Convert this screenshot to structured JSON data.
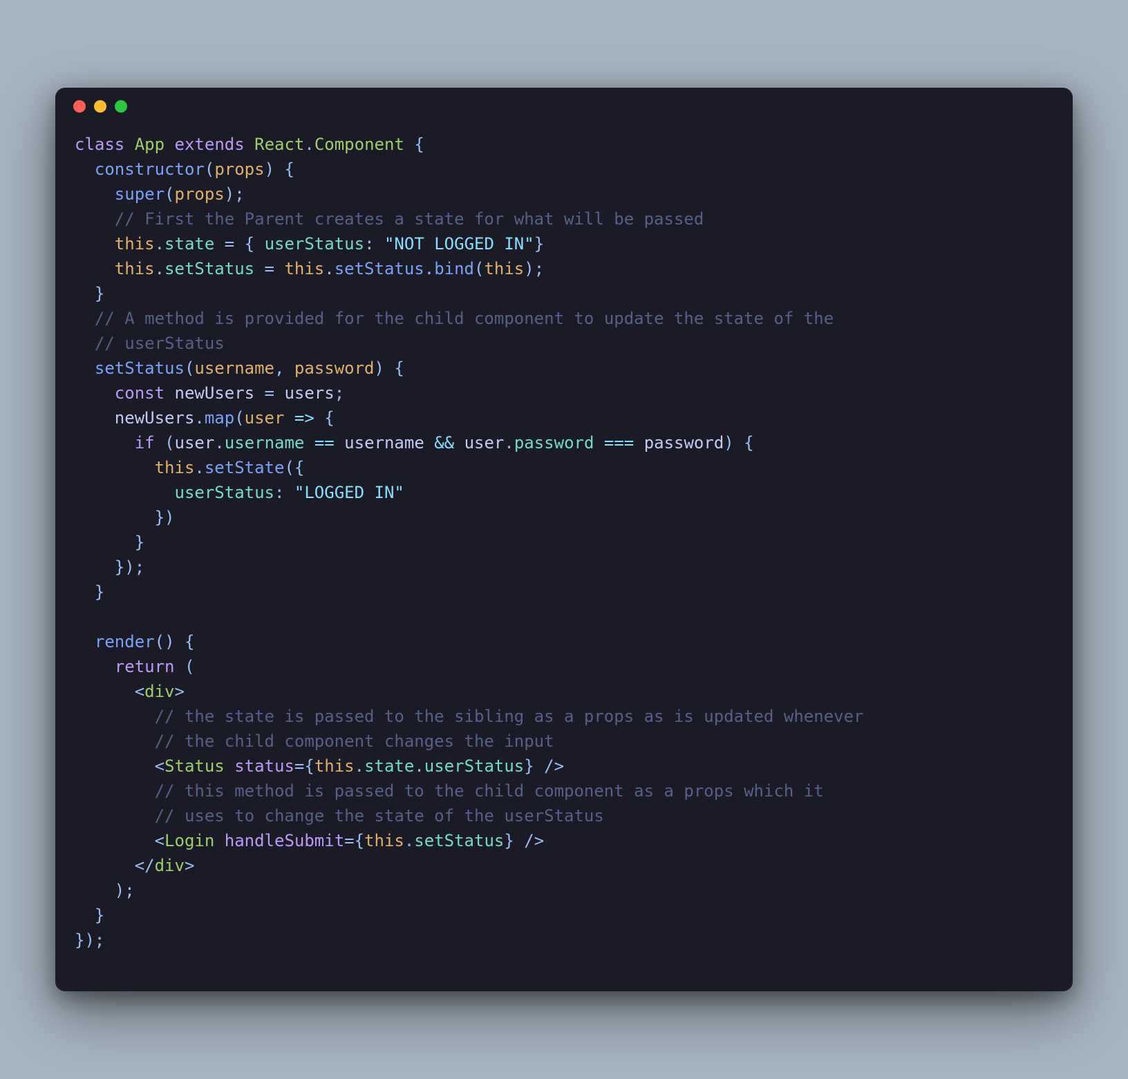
{
  "colors": {
    "page_bg": "#a5b3c0",
    "window_bg": "#1a1b26",
    "traffic_close": "#ff5f56",
    "traffic_min": "#ffbd2e",
    "traffic_zoom": "#27c93f",
    "keyword": "#bb9af7",
    "classname": "#9ece6a",
    "function": "#7aa2f7",
    "param": "#e0af68",
    "property": "#73daca",
    "string": "#89ddff",
    "punct": "#9abdf5",
    "operator": "#89ddff",
    "comment": "#565f89",
    "default": "#c0caf5"
  },
  "code": {
    "lines": [
      [
        {
          "t": "class",
          "c": "kw"
        },
        {
          "t": " "
        },
        {
          "t": "App",
          "c": "class"
        },
        {
          "t": " "
        },
        {
          "t": "extends",
          "c": "kw"
        },
        {
          "t": " "
        },
        {
          "t": "React",
          "c": "class"
        },
        {
          "t": ".",
          "c": "punc"
        },
        {
          "t": "Component",
          "c": "class"
        },
        {
          "t": " "
        },
        {
          "t": "{",
          "c": "punc"
        }
      ],
      [
        {
          "t": "  "
        },
        {
          "t": "constructor",
          "c": "fn"
        },
        {
          "t": "(",
          "c": "punc"
        },
        {
          "t": "props",
          "c": "param"
        },
        {
          "t": ")",
          "c": "punc"
        },
        {
          "t": " "
        },
        {
          "t": "{",
          "c": "punc"
        }
      ],
      [
        {
          "t": "    "
        },
        {
          "t": "super",
          "c": "fn"
        },
        {
          "t": "(",
          "c": "punc"
        },
        {
          "t": "props",
          "c": "param"
        },
        {
          "t": ")",
          "c": "punc"
        },
        {
          "t": ";",
          "c": "punc"
        }
      ],
      [
        {
          "t": "    "
        },
        {
          "t": "// First the Parent creates a state for what will be passed",
          "c": "cmt"
        }
      ],
      [
        {
          "t": "    "
        },
        {
          "t": "this",
          "c": "this"
        },
        {
          "t": ".",
          "c": "punc"
        },
        {
          "t": "state",
          "c": "prop"
        },
        {
          "t": " "
        },
        {
          "t": "=",
          "c": "punc"
        },
        {
          "t": " "
        },
        {
          "t": "{",
          "c": "punc"
        },
        {
          "t": " "
        },
        {
          "t": "userStatus",
          "c": "key"
        },
        {
          "t": ":",
          "c": "punc"
        },
        {
          "t": " "
        },
        {
          "t": "\"NOT LOGGED IN\"",
          "c": "str"
        },
        {
          "t": "}",
          "c": "punc"
        }
      ],
      [
        {
          "t": "    "
        },
        {
          "t": "this",
          "c": "this"
        },
        {
          "t": ".",
          "c": "punc"
        },
        {
          "t": "setStatus",
          "c": "prop"
        },
        {
          "t": " "
        },
        {
          "t": "=",
          "c": "punc"
        },
        {
          "t": " "
        },
        {
          "t": "this",
          "c": "this"
        },
        {
          "t": ".",
          "c": "punc"
        },
        {
          "t": "setStatus",
          "c": "fn"
        },
        {
          "t": ".",
          "c": "punc"
        },
        {
          "t": "bind",
          "c": "fn"
        },
        {
          "t": "(",
          "c": "punc"
        },
        {
          "t": "this",
          "c": "this"
        },
        {
          "t": ")",
          "c": "punc"
        },
        {
          "t": ";",
          "c": "punc"
        }
      ],
      [
        {
          "t": "  "
        },
        {
          "t": "}",
          "c": "punc"
        }
      ],
      [
        {
          "t": "  "
        },
        {
          "t": "// A method is provided for the child component to update the state of the",
          "c": "cmt"
        }
      ],
      [
        {
          "t": "  "
        },
        {
          "t": "// userStatus",
          "c": "cmt"
        }
      ],
      [
        {
          "t": "  "
        },
        {
          "t": "setStatus",
          "c": "fn"
        },
        {
          "t": "(",
          "c": "punc"
        },
        {
          "t": "username",
          "c": "param"
        },
        {
          "t": ",",
          "c": "punc"
        },
        {
          "t": " "
        },
        {
          "t": "password",
          "c": "param"
        },
        {
          "t": ")",
          "c": "punc"
        },
        {
          "t": " "
        },
        {
          "t": "{",
          "c": "punc"
        }
      ],
      [
        {
          "t": "    "
        },
        {
          "t": "const",
          "c": "kw"
        },
        {
          "t": " "
        },
        {
          "t": "newUsers",
          "c": "var"
        },
        {
          "t": " "
        },
        {
          "t": "=",
          "c": "punc"
        },
        {
          "t": " "
        },
        {
          "t": "users",
          "c": "var"
        },
        {
          "t": ";",
          "c": "punc"
        }
      ],
      [
        {
          "t": "    "
        },
        {
          "t": "newUsers",
          "c": "var"
        },
        {
          "t": ".",
          "c": "punc"
        },
        {
          "t": "map",
          "c": "fn"
        },
        {
          "t": "(",
          "c": "punc"
        },
        {
          "t": "user",
          "c": "param"
        },
        {
          "t": " "
        },
        {
          "t": "=>",
          "c": "op"
        },
        {
          "t": " "
        },
        {
          "t": "{",
          "c": "punc"
        }
      ],
      [
        {
          "t": "      "
        },
        {
          "t": "if",
          "c": "kw"
        },
        {
          "t": " "
        },
        {
          "t": "(",
          "c": "punc"
        },
        {
          "t": "user",
          "c": "var"
        },
        {
          "t": ".",
          "c": "punc"
        },
        {
          "t": "username",
          "c": "prop"
        },
        {
          "t": " "
        },
        {
          "t": "==",
          "c": "op"
        },
        {
          "t": " "
        },
        {
          "t": "username",
          "c": "var"
        },
        {
          "t": " "
        },
        {
          "t": "&&",
          "c": "op"
        },
        {
          "t": " "
        },
        {
          "t": "user",
          "c": "var"
        },
        {
          "t": ".",
          "c": "punc"
        },
        {
          "t": "password",
          "c": "prop"
        },
        {
          "t": " "
        },
        {
          "t": "===",
          "c": "op"
        },
        {
          "t": " "
        },
        {
          "t": "password",
          "c": "var"
        },
        {
          "t": ")",
          "c": "punc"
        },
        {
          "t": " "
        },
        {
          "t": "{",
          "c": "punc"
        }
      ],
      [
        {
          "t": "        "
        },
        {
          "t": "this",
          "c": "this"
        },
        {
          "t": ".",
          "c": "punc"
        },
        {
          "t": "setState",
          "c": "fn"
        },
        {
          "t": "(",
          "c": "punc"
        },
        {
          "t": "{",
          "c": "punc"
        }
      ],
      [
        {
          "t": "          "
        },
        {
          "t": "userStatus",
          "c": "key"
        },
        {
          "t": ":",
          "c": "punc"
        },
        {
          "t": " "
        },
        {
          "t": "\"LOGGED IN\"",
          "c": "str"
        }
      ],
      [
        {
          "t": "        "
        },
        {
          "t": "}",
          "c": "punc"
        },
        {
          "t": ")",
          "c": "punc"
        }
      ],
      [
        {
          "t": "      "
        },
        {
          "t": "}",
          "c": "punc"
        }
      ],
      [
        {
          "t": "    "
        },
        {
          "t": "}",
          "c": "punc"
        },
        {
          "t": ")",
          "c": "punc"
        },
        {
          "t": ";",
          "c": "punc"
        }
      ],
      [
        {
          "t": "  "
        },
        {
          "t": "}",
          "c": "punc"
        }
      ],
      [
        {
          "t": ""
        }
      ],
      [
        {
          "t": "  "
        },
        {
          "t": "render",
          "c": "fn"
        },
        {
          "t": "(",
          "c": "punc"
        },
        {
          "t": ")",
          "c": "punc"
        },
        {
          "t": " "
        },
        {
          "t": "{",
          "c": "punc"
        }
      ],
      [
        {
          "t": "    "
        },
        {
          "t": "return",
          "c": "kw"
        },
        {
          "t": " "
        },
        {
          "t": "(",
          "c": "punc"
        }
      ],
      [
        {
          "t": "      "
        },
        {
          "t": "<",
          "c": "punc"
        },
        {
          "t": "div",
          "c": "class"
        },
        {
          "t": ">",
          "c": "punc"
        }
      ],
      [
        {
          "t": "        "
        },
        {
          "t": "// the state is passed to the sibling as a props as is updated whenever",
          "c": "cmt"
        }
      ],
      [
        {
          "t": "        "
        },
        {
          "t": "// the child component changes the input",
          "c": "cmt"
        }
      ],
      [
        {
          "t": "        "
        },
        {
          "t": "<",
          "c": "punc"
        },
        {
          "t": "Status",
          "c": "class"
        },
        {
          "t": " "
        },
        {
          "t": "status",
          "c": "attr"
        },
        {
          "t": "=",
          "c": "punc"
        },
        {
          "t": "{",
          "c": "punc"
        },
        {
          "t": "this",
          "c": "this"
        },
        {
          "t": ".",
          "c": "punc"
        },
        {
          "t": "state",
          "c": "prop"
        },
        {
          "t": ".",
          "c": "punc"
        },
        {
          "t": "userStatus",
          "c": "prop"
        },
        {
          "t": "}",
          "c": "punc"
        },
        {
          "t": " "
        },
        {
          "t": "/>",
          "c": "punc"
        }
      ],
      [
        {
          "t": "        "
        },
        {
          "t": "// this method is passed to the child component as a props which it",
          "c": "cmt"
        }
      ],
      [
        {
          "t": "        "
        },
        {
          "t": "// uses to change the state of the userStatus",
          "c": "cmt"
        }
      ],
      [
        {
          "t": "        "
        },
        {
          "t": "<",
          "c": "punc"
        },
        {
          "t": "Login",
          "c": "class"
        },
        {
          "t": " "
        },
        {
          "t": "handleSubmit",
          "c": "attr"
        },
        {
          "t": "=",
          "c": "punc"
        },
        {
          "t": "{",
          "c": "punc"
        },
        {
          "t": "this",
          "c": "this"
        },
        {
          "t": ".",
          "c": "punc"
        },
        {
          "t": "setStatus",
          "c": "prop"
        },
        {
          "t": "}",
          "c": "punc"
        },
        {
          "t": " "
        },
        {
          "t": "/>",
          "c": "punc"
        }
      ],
      [
        {
          "t": "      "
        },
        {
          "t": "</",
          "c": "punc"
        },
        {
          "t": "div",
          "c": "class"
        },
        {
          "t": ">",
          "c": "punc"
        }
      ],
      [
        {
          "t": "    "
        },
        {
          "t": ")",
          "c": "punc"
        },
        {
          "t": ";",
          "c": "punc"
        }
      ],
      [
        {
          "t": "  "
        },
        {
          "t": "}",
          "c": "punc"
        }
      ],
      [
        {
          "t": "}",
          "c": "punc"
        },
        {
          "t": ")",
          "c": "punc"
        },
        {
          "t": ";",
          "c": "punc"
        }
      ]
    ]
  }
}
